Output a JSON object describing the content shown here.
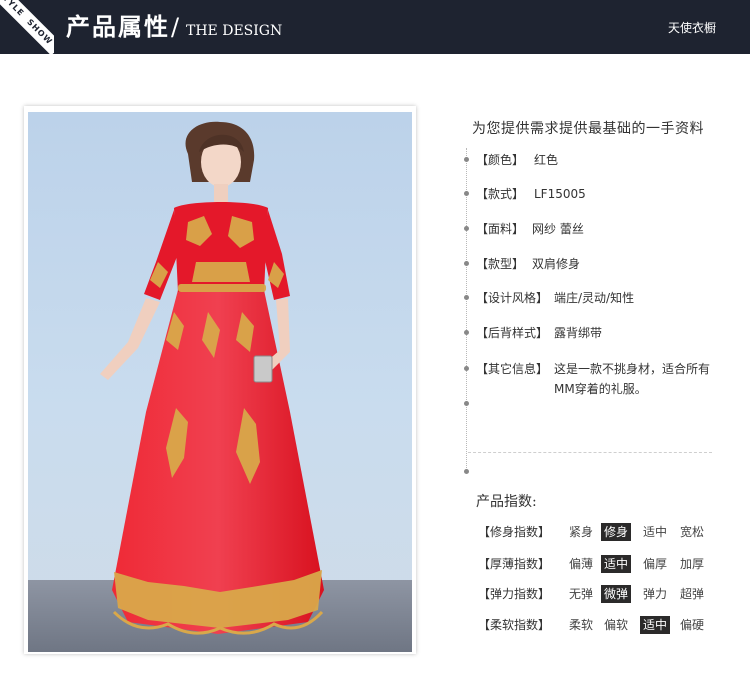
{
  "header": {
    "corner_tag": [
      "STYLE",
      "SHOW"
    ],
    "title_cn": "产品属性",
    "title_slash": "/",
    "title_en": "THE DESIGN",
    "brand": "天使衣橱"
  },
  "photo": {
    "alt": "红色 蕾丝 礼服"
  },
  "info": {
    "heading": "为您提供需求提供最基础的一手资料",
    "attributes": [
      {
        "label": "【颜色】",
        "value": "红色"
      },
      {
        "label": "【款式】",
        "value": "LF15005"
      },
      {
        "label": "【面料】",
        "value": "网纱 蕾丝"
      },
      {
        "label": "【款型】",
        "value": "双肩修身"
      },
      {
        "label": "【设计风格】",
        "value": "端庄/灵动/知性"
      },
      {
        "label": "【后背样式】",
        "value": "露背绑带"
      },
      {
        "label": "【其它信息】",
        "value": "这是一款不挑身材，适合所有MM穿着的礼服。"
      }
    ]
  },
  "index": {
    "title": "产品指数:",
    "rows": [
      {
        "label": "【修身指数】",
        "options": [
          "紧身",
          "修身",
          "适中",
          "宽松"
        ],
        "selected": 1
      },
      {
        "label": "【厚薄指数】",
        "options": [
          "偏薄",
          "适中",
          "偏厚",
          "加厚"
        ],
        "selected": 1
      },
      {
        "label": "【弹力指数】",
        "options": [
          "无弹",
          "微弹",
          "弹力",
          "超弹"
        ],
        "selected": 1
      },
      {
        "label": "【柔软指数】",
        "options": [
          "柔软",
          "偏软",
          "适中",
          "偏硬"
        ],
        "selected": 2
      }
    ]
  },
  "colors": {
    "header_bg": "#1e2330",
    "dress_red": "#e3172a",
    "lace_gold": "#d9a84a",
    "selected_bg": "#2b2a2a"
  }
}
